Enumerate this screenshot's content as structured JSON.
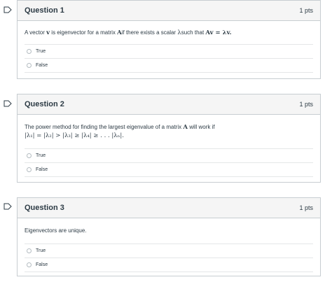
{
  "questions": [
    {
      "title": "Question 1",
      "points": "1 pts",
      "text_before": "A vector ",
      "math_v": "v",
      "text_mid": " is eigenvector for a matrix ",
      "math_A": "A",
      "text_mid2": "if there exists a scalar ",
      "math_lambda": "λ",
      "text_mid3": "such that ",
      "math_eq": "Av = λv.",
      "answers": [
        "True",
        "False"
      ]
    },
    {
      "title": "Question 2",
      "points": "1 pts",
      "text_line1": "The power method for finding the largest eigenvalue of a matrix ",
      "math_A": "A",
      "text_line1_end": " will work if",
      "math_line2": "|λ₁| = |λ₂| > |λ₃| ≥ |λ₄| ≥ . . . |λₙ|.",
      "answers": [
        "True",
        "False"
      ]
    },
    {
      "title": "Question 3",
      "points": "1 pts",
      "text": "Eigenvectors are unique.",
      "answers": [
        "True",
        "False"
      ]
    }
  ]
}
